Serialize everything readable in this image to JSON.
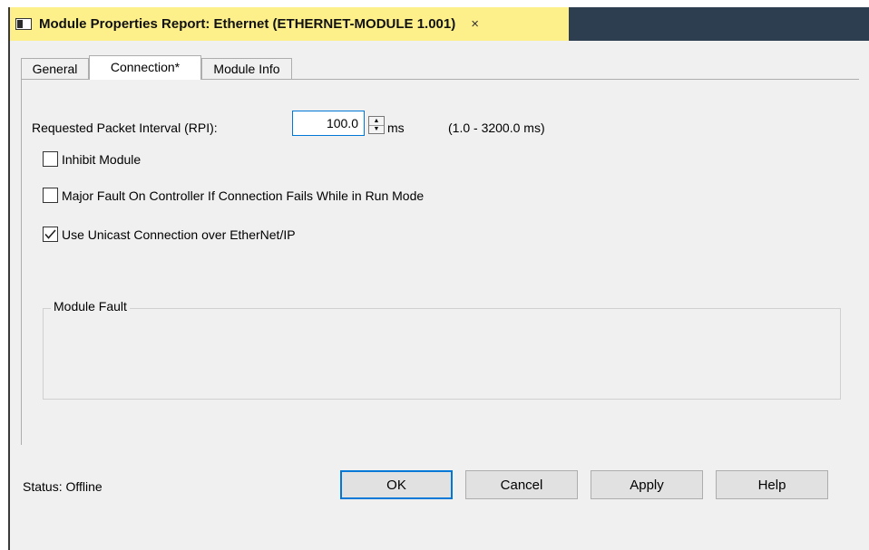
{
  "window": {
    "title": "Module Properties Report: Ethernet (ETHERNET-MODULE 1.001)",
    "close_glyph": "×"
  },
  "tabs": [
    {
      "label": "General",
      "active": false
    },
    {
      "label": "Connection*",
      "active": true
    },
    {
      "label": "Module Info",
      "active": false
    }
  ],
  "connection": {
    "rpi_label": "Requested Packet Interval (RPI):",
    "rpi_value": "100.0",
    "rpi_unit": "ms",
    "rpi_range": "(1.0 - 3200.0 ms)",
    "checkboxes": [
      {
        "label": "Inhibit Module",
        "checked": false
      },
      {
        "label": "Major Fault On Controller If Connection Fails While in Run Mode",
        "checked": false
      },
      {
        "label": "Use Unicast Connection over EtherNet/IP",
        "checked": true
      }
    ],
    "module_fault_label": "Module Fault"
  },
  "status": {
    "text": "Status:  Offline"
  },
  "buttons": {
    "ok": "OK",
    "cancel": "Cancel",
    "apply": "Apply",
    "help": "Help"
  },
  "icons": {
    "window": "module-window-icon",
    "close": "close-icon",
    "spin_up": "spin-up-icon",
    "spin_down": "spin-down-icon",
    "checkmark": "checkmark-icon"
  },
  "colors": {
    "title_tab": "#fdf08a",
    "title_bar": "#2d3e50",
    "focus_blue": "#0078d7",
    "window_bg": "#f0f0f0"
  }
}
